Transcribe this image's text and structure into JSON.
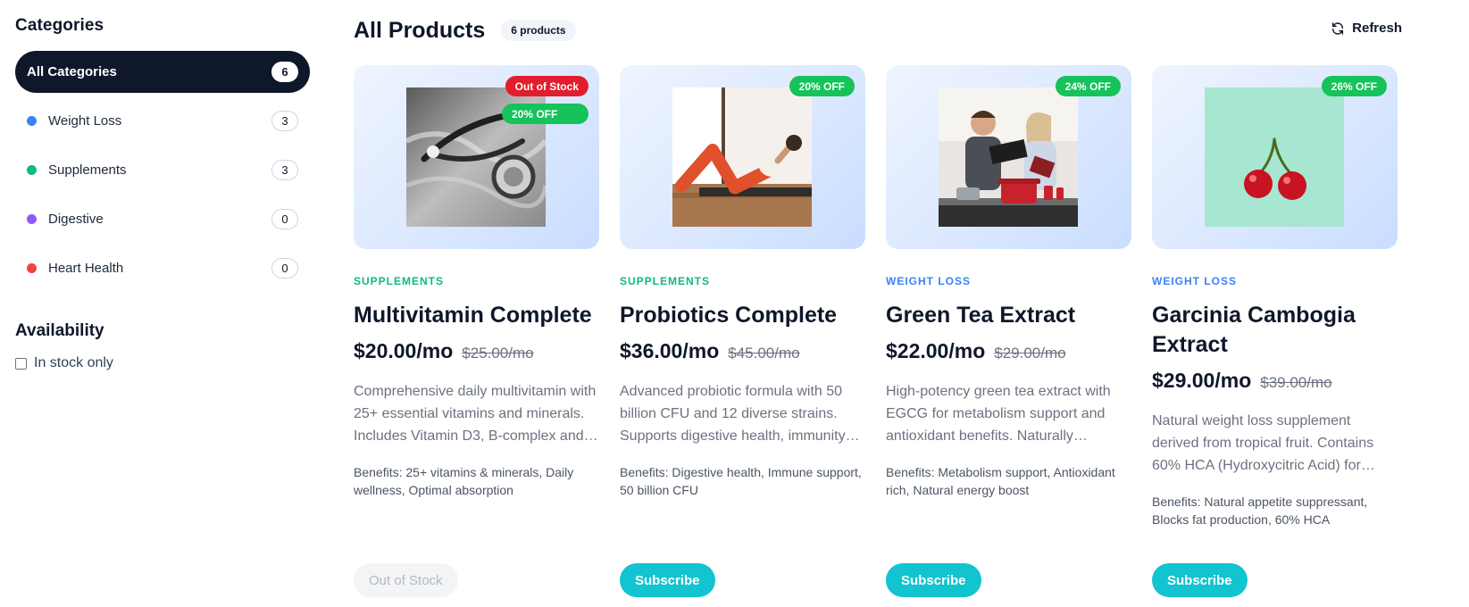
{
  "sidebar": {
    "categories_heading": "Categories",
    "categories": [
      {
        "label": "All Categories",
        "count": "6",
        "active": true,
        "color": null
      },
      {
        "label": "Weight Loss",
        "count": "3",
        "active": false,
        "color": "#3b82f6"
      },
      {
        "label": "Supplements",
        "count": "3",
        "active": false,
        "color": "#10b981"
      },
      {
        "label": "Digestive",
        "count": "0",
        "active": false,
        "color": "#8b5cf6"
      },
      {
        "label": "Heart Health",
        "count": "0",
        "active": false,
        "color": "#ef4444"
      }
    ],
    "availability_heading": "Availability",
    "in_stock_label": "In stock only",
    "in_stock_checked": false
  },
  "header": {
    "title": "All Products",
    "count_badge": "6 products",
    "refresh_label": "Refresh"
  },
  "products": [
    {
      "category": "SUPPLEMENTS",
      "name": "Multivitamin Complete",
      "price": "$20.00/mo",
      "old_price": "$25.00/mo",
      "description": "Comprehensive daily multivitamin with 25+ essential vitamins and minerals. Includes Vitamin D3, B-complex and more.",
      "benefits": "Benefits: 25+ vitamins & minerals, Daily wellness, Optimal absorption",
      "stock_badge": "Out of Stock",
      "discount_badge": "20% OFF",
      "action_label": "Out of Stock",
      "in_stock": false,
      "image": "stethoscope-photo"
    },
    {
      "category": "SUPPLEMENTS",
      "name": "Probiotics Complete",
      "price": "$36.00/mo",
      "old_price": "$45.00/mo",
      "description": "Advanced probiotic formula with 50 billion CFU and 12 diverse strains. Supports digestive health, immunity and more.",
      "benefits": "Benefits: Digestive health, Immune support, 50 billion CFU",
      "discount_badge": "20% OFF",
      "action_label": "Subscribe",
      "in_stock": true,
      "image": "workout-photo"
    },
    {
      "category": "WEIGHT LOSS",
      "name": "Green Tea Extract",
      "price": "$22.00/mo",
      "old_price": "$29.00/mo",
      "description": "High-potency green tea extract with EGCG for metabolism support and antioxidant benefits. Naturally sourced.",
      "benefits": "Benefits: Metabolism support, Antioxidant rich, Natural energy boost",
      "discount_badge": "24% OFF",
      "action_label": "Subscribe",
      "in_stock": true,
      "image": "cooking-couple-photo"
    },
    {
      "category": "WEIGHT LOSS",
      "name": "Garcinia Cambogia Extract",
      "price": "$29.00/mo",
      "old_price": "$39.00/mo",
      "description": "Natural weight loss supplement derived from tropical fruit. Contains 60% HCA (Hydroxycitric Acid) for results.",
      "benefits": "Benefits: Natural appetite suppressant, Blocks fat production, 60% HCA",
      "discount_badge": "26% OFF",
      "action_label": "Subscribe",
      "in_stock": true,
      "image": "cherries-photo"
    }
  ],
  "colors": {
    "active_bg": "#0f172a",
    "subscribe": "#12c4cf",
    "out_badge": "#e11d2e",
    "discount_badge": "#16c25a",
    "supplements": "#10b981",
    "weight_loss": "#3b82f6"
  }
}
